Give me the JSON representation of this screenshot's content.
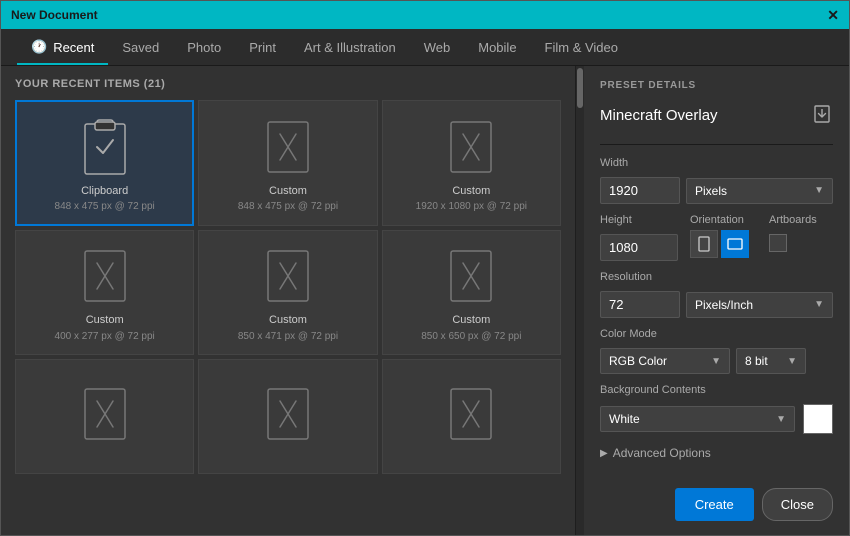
{
  "titleBar": {
    "title": "New Document",
    "closeLabel": "✕"
  },
  "tabs": [
    {
      "id": "recent",
      "label": "Recent",
      "active": true,
      "icon": "🕐"
    },
    {
      "id": "saved",
      "label": "Saved",
      "active": false,
      "icon": ""
    },
    {
      "id": "photo",
      "label": "Photo",
      "active": false,
      "icon": ""
    },
    {
      "id": "print",
      "label": "Print",
      "active": false,
      "icon": ""
    },
    {
      "id": "art",
      "label": "Art & Illustration",
      "active": false,
      "icon": ""
    },
    {
      "id": "web",
      "label": "Web",
      "active": false,
      "icon": ""
    },
    {
      "id": "mobile",
      "label": "Mobile",
      "active": false,
      "icon": ""
    },
    {
      "id": "film",
      "label": "Film & Video",
      "active": false,
      "icon": ""
    }
  ],
  "recentHeader": "YOUR RECENT ITEMS (21)",
  "items": [
    {
      "id": 1,
      "type": "clipboard",
      "label": "Clipboard",
      "sub": "848 x 475 px @ 72 ppi",
      "selected": true
    },
    {
      "id": 2,
      "type": "custom",
      "label": "Custom",
      "sub": "848 x 475 px @ 72 ppi",
      "selected": false
    },
    {
      "id": 3,
      "type": "custom",
      "label": "Custom",
      "sub": "1920 x 1080 px @ 72 ppi",
      "selected": false
    },
    {
      "id": 4,
      "type": "custom",
      "label": "Custom",
      "sub": "400 x 277 px @ 72 ppi",
      "selected": false
    },
    {
      "id": 5,
      "type": "custom",
      "label": "Custom",
      "sub": "850 x 471 px @ 72 ppi",
      "selected": false
    },
    {
      "id": 6,
      "type": "custom",
      "label": "Custom",
      "sub": "850 x 650 px @ 72 ppi",
      "selected": false
    },
    {
      "id": 7,
      "type": "custom",
      "label": "",
      "sub": "",
      "selected": false
    },
    {
      "id": 8,
      "type": "custom",
      "label": "",
      "sub": "",
      "selected": false
    },
    {
      "id": 9,
      "type": "custom",
      "label": "",
      "sub": "",
      "selected": false
    }
  ],
  "presetDetails": {
    "sectionLabel": "PRESET DETAILS",
    "presetName": "Minecraft Overlay",
    "saveIconLabel": "⬇",
    "widthLabel": "Width",
    "widthValue": "1920",
    "widthUnit": "Pixels",
    "heightLabel": "Height",
    "heightValue": "1080",
    "orientationLabel": "Orientation",
    "artboardsLabel": "Artboards",
    "resolutionLabel": "Resolution",
    "resolutionValue": "72",
    "resolutionUnit": "Pixels/Inch",
    "colorModeLabel": "Color Mode",
    "colorModeValue": "RGB Color",
    "bitDepthValue": "8 bit",
    "bgContentsLabel": "Background Contents",
    "bgContentsValue": "White",
    "advancedLabel": "Advanced Options"
  },
  "buttons": {
    "create": "Create",
    "close": "Close"
  },
  "colors": {
    "titleBarBg": "#00b7c3",
    "activeTab": "#00b7c3",
    "selectedCard": "#0078d7",
    "createBtn": "#0078d7"
  }
}
